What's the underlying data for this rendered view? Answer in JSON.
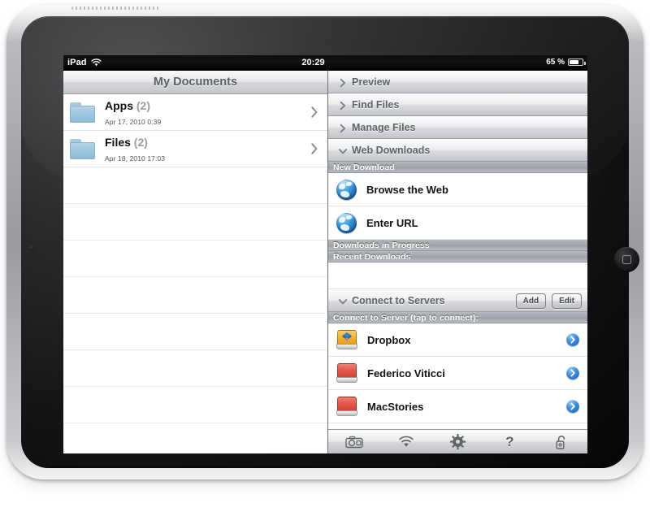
{
  "device": {
    "name": "iPad",
    "orientation": "landscape"
  },
  "status_bar": {
    "carrier": "iPad",
    "wifi_icon": "wifi-icon",
    "time": "20:29",
    "battery_percent": "65 %"
  },
  "master_pane": {
    "title": "My Documents",
    "rows": [
      {
        "icon": "folder-icon",
        "name": "Apps",
        "count": "(2)",
        "date": "Apr 17, 2010 0:39",
        "accessory": "chevron-right-icon"
      },
      {
        "icon": "folder-icon",
        "name": "Files",
        "count": "(2)",
        "date": "Apr 18, 2010 17:03",
        "accessory": "chevron-right-icon"
      }
    ],
    "empty_row_count": 8
  },
  "detail_pane": {
    "accordions": [
      {
        "label": "Preview",
        "state": "collapsed",
        "chevron": "chevron-right-icon"
      },
      {
        "label": "Find Files",
        "state": "collapsed",
        "chevron": "chevron-right-icon"
      },
      {
        "label": "Manage Files",
        "state": "collapsed",
        "chevron": "chevron-right-icon"
      },
      {
        "label": "Web Downloads",
        "state": "expanded",
        "chevron": "chevron-down-icon"
      },
      {
        "label": "Connect to Servers",
        "state": "expanded",
        "chevron": "chevron-down-icon"
      }
    ],
    "web_downloads": {
      "section_new_download": "New Download",
      "items": [
        {
          "icon": "globe-icon",
          "label": "Browse the Web"
        },
        {
          "icon": "globe-icon",
          "label": "Enter URL"
        }
      ],
      "section_in_progress": "Downloads in Progress",
      "section_recent": "Recent Downloads"
    },
    "connect_to_servers": {
      "add_button": "Add",
      "edit_button": "Edit",
      "section_header": "Connect to Server (tap to connect):",
      "servers": [
        {
          "icon": "drive-icon-orange",
          "label": "Dropbox",
          "accessory": "disclosure-icon",
          "color": "#f4b13a"
        },
        {
          "icon": "drive-icon-red",
          "label": "Federico Viticci",
          "accessory": "disclosure-icon",
          "color": "#e2594c"
        },
        {
          "icon": "drive-icon-red",
          "label": "MacStories",
          "accessory": "disclosure-icon",
          "color": "#e2594c"
        },
        {
          "icon": "drive-icon-magenta",
          "label": "",
          "accessory": "disclosure-icon",
          "color": "#d627c8"
        }
      ]
    }
  },
  "toolbar": {
    "buttons": [
      {
        "icon": "camera-icon",
        "label": ""
      },
      {
        "icon": "wifi-icon",
        "label": ""
      },
      {
        "icon": "gear-icon",
        "label": ""
      },
      {
        "icon": "help-icon",
        "label": "?"
      },
      {
        "icon": "unlock-icon",
        "label": ""
      }
    ]
  },
  "colors": {
    "accent_blue": "#1464bd",
    "folder_blue": "#9cc4dd",
    "header_gray": "#a4a8af",
    "toolbar_gray": "#d6d7da"
  }
}
